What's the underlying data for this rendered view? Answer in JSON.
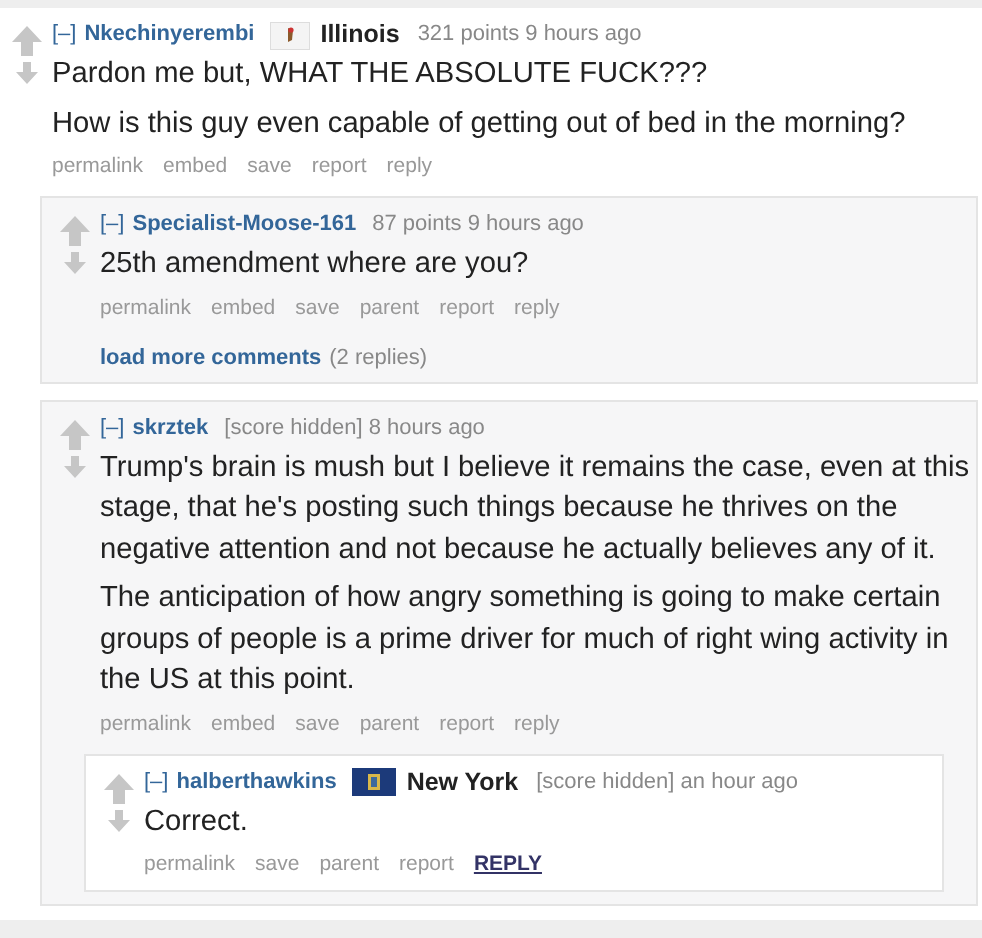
{
  "comments": [
    {
      "collapse": "[–]",
      "author": "Nkechinyerembi",
      "flair": {
        "kind": "illinois",
        "text": "Illinois"
      },
      "score": "321 points",
      "time": "9 hours ago",
      "body": [
        "Pardon me but, WHAT THE ABSOLUTE FUCK???",
        "How is this guy even capable of getting out of bed in the morning?"
      ],
      "actions": [
        {
          "label": "permalink",
          "emphasized": false
        },
        {
          "label": "embed",
          "emphasized": false
        },
        {
          "label": "save",
          "emphasized": false
        },
        {
          "label": "report",
          "emphasized": false
        },
        {
          "label": "reply",
          "emphasized": false
        }
      ],
      "children": [
        {
          "collapse": "[–]",
          "author": "Specialist-Moose-161",
          "score": "87 points",
          "time": "9 hours ago",
          "body": [
            "25th amendment where are you?"
          ],
          "actions": [
            {
              "label": "permalink",
              "emphasized": false
            },
            {
              "label": "embed",
              "emphasized": false
            },
            {
              "label": "save",
              "emphasized": false
            },
            {
              "label": "parent",
              "emphasized": false
            },
            {
              "label": "report",
              "emphasized": false
            },
            {
              "label": "reply",
              "emphasized": false
            }
          ],
          "load_more": {
            "label": "load more comments",
            "count": "(2 replies)"
          }
        },
        {
          "collapse": "[–]",
          "author": "skrztek",
          "score": "[score hidden]",
          "time": "8 hours ago",
          "body": [
            "Trump's brain is mush but I believe it remains the case, even at this stage, that he's posting such things because he thrives on the negative attention and not because he actually believes any of it.",
            "The anticipation of how angry something is going to make certain groups of people is a prime driver for much of right wing activity in the US at this point."
          ],
          "actions": [
            {
              "label": "permalink",
              "emphasized": false
            },
            {
              "label": "embed",
              "emphasized": false
            },
            {
              "label": "save",
              "emphasized": false
            },
            {
              "label": "parent",
              "emphasized": false
            },
            {
              "label": "report",
              "emphasized": false
            },
            {
              "label": "reply",
              "emphasized": false
            }
          ],
          "children": [
            {
              "collapse": "[–]",
              "author": "halberthawkins",
              "flair": {
                "kind": "new-york",
                "text": "New York"
              },
              "score": "[score hidden]",
              "time": "an hour ago",
              "body": [
                "Correct."
              ],
              "actions": [
                {
                  "label": "permalink",
                  "emphasized": false
                },
                {
                  "label": "save",
                  "emphasized": false
                },
                {
                  "label": "parent",
                  "emphasized": false
                },
                {
                  "label": "report",
                  "emphasized": false
                },
                {
                  "label": "REPLY",
                  "emphasized": true
                }
              ]
            }
          ]
        }
      ]
    }
  ]
}
